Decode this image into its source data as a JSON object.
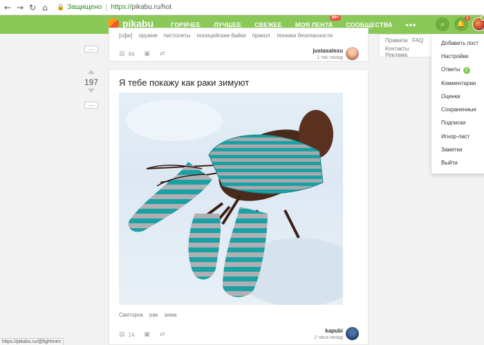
{
  "browser": {
    "secure_label": "Защищено",
    "url_scheme": "https://",
    "url_rest": "pikabu.ru/hot"
  },
  "header": {
    "logo_text": "pikabu",
    "menu": [
      {
        "label": "Горячее",
        "active": true
      },
      {
        "label": "Лучшее"
      },
      {
        "label": "Свежее"
      },
      {
        "label": "Моя лента",
        "badge": "99+"
      },
      {
        "label": "Сообщества"
      }
    ],
    "more": "•••",
    "notifications_count": "5"
  },
  "prev_post": {
    "tags": [
      "[сфе]",
      "оружие",
      "пистолеты",
      "полицейские байки",
      "прикол",
      "техника безопасности"
    ],
    "comments": "94",
    "author": "justasalexu",
    "time": "1 час назад"
  },
  "post": {
    "rating": "197",
    "title": "Я тебе покажу как раки зимуют",
    "tags": [
      "Свиторок",
      "рак",
      "зима"
    ],
    "comments": "14",
    "author": "kapubi",
    "time": "2 часа назад"
  },
  "sidebar": {
    "links_row1": [
      "Правила",
      "FAQ"
    ],
    "links_row2": [
      "Контакты",
      "Реклама"
    ]
  },
  "dropdown": {
    "items": [
      {
        "label": "Добавить пост"
      },
      {
        "label": "Настройки"
      },
      {
        "label": "Ответы",
        "badge": "1"
      },
      {
        "label": "Комментарии"
      },
      {
        "label": "Оценки"
      },
      {
        "label": "Сохраненные"
      },
      {
        "label": "Подписки"
      },
      {
        "label": "Игнор-лист"
      },
      {
        "label": "Заметки"
      },
      {
        "label": "Выйти"
      }
    ]
  },
  "status_url": "https://pikabu.ru/@lightmen",
  "colors": {
    "brand_green": "#8ac858",
    "badge_red": "#ea4e3c"
  },
  "icons": [
    "back-icon",
    "forward-icon",
    "reload-icon",
    "home-icon",
    "lock-icon",
    "search-icon",
    "bell-icon",
    "comment-icon",
    "save-icon",
    "share-icon"
  ]
}
